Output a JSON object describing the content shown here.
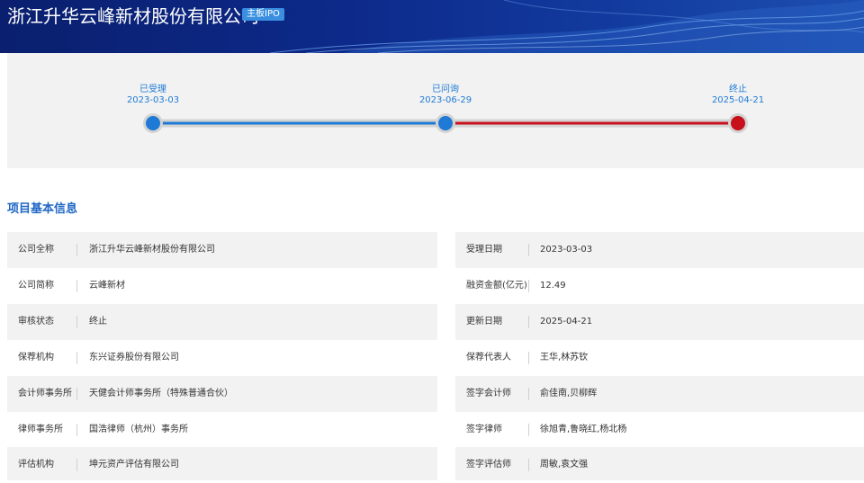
{
  "header": {
    "title": "浙江升华云峰新材股份有限公司",
    "badge": "主板IPO"
  },
  "timeline": {
    "stages": [
      {
        "label": "已受理",
        "date": "2023-03-03"
      },
      {
        "label": "已问询",
        "date": "2023-06-29"
      },
      {
        "label": "终止",
        "date": "2025-04-21"
      }
    ],
    "colors": {
      "done": "#1f7ad6",
      "terminated": "#c8101c",
      "track": "#d3d3d3"
    }
  },
  "section": {
    "title": "项目基本信息"
  },
  "info": {
    "left": [
      {
        "label": "公司全称",
        "value": "浙江升华云峰新材股份有限公司"
      },
      {
        "label": "公司简称",
        "value": "云峰新材"
      },
      {
        "label": "审核状态",
        "value": "终止"
      },
      {
        "label": "保荐机构",
        "value": "东兴证券股份有限公司"
      },
      {
        "label": "会计师事务所",
        "value": "天健会计师事务所（特殊普通合伙）"
      },
      {
        "label": "律师事务所",
        "value": "国浩律师（杭州）事务所"
      },
      {
        "label": "评估机构",
        "value": "坤元资产评估有限公司"
      }
    ],
    "right": [
      {
        "label": "受理日期",
        "value": "2023-03-03"
      },
      {
        "label": "融资金额(亿元)",
        "value": "12.49"
      },
      {
        "label": "更新日期",
        "value": "2025-04-21"
      },
      {
        "label": "保荐代表人",
        "value": "王华,林苏钦"
      },
      {
        "label": "签字会计师",
        "value": "俞佳南,贝柳辉"
      },
      {
        "label": "签字律师",
        "value": "徐旭青,鲁晓红,杨北杨"
      },
      {
        "label": "签字评估师",
        "value": "周敏,袁文强"
      }
    ]
  }
}
